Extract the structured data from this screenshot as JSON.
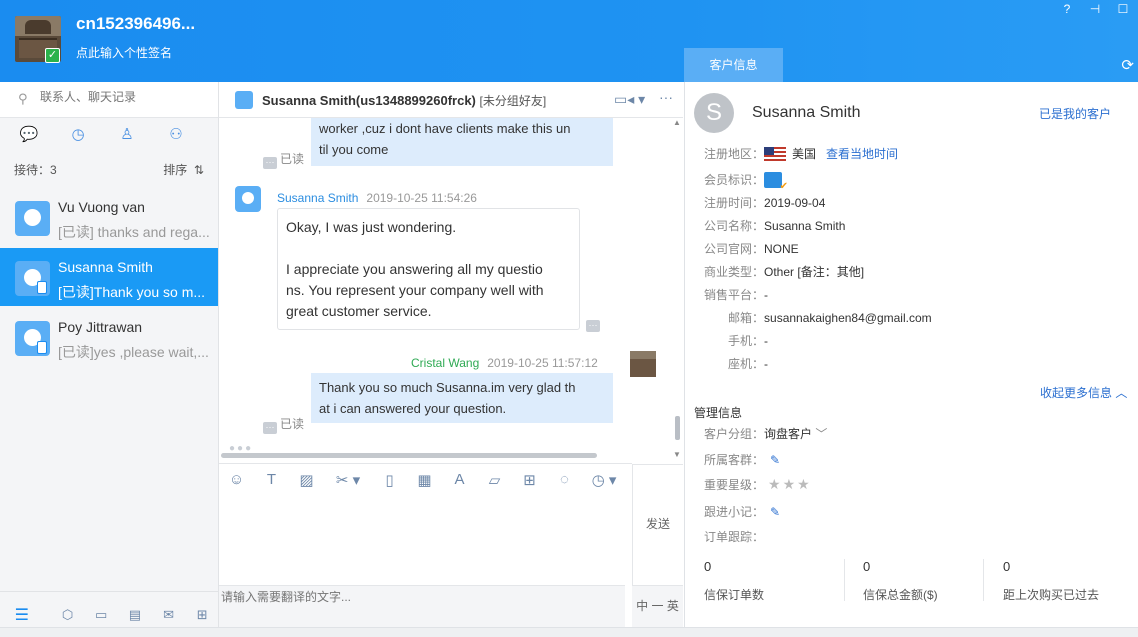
{
  "header": {
    "username": "cn152396496...",
    "signature": "点此输入个性签名",
    "customer_tab": "客户信息",
    "ctrl_help": "?",
    "ctrl_pin": "⊣",
    "ctrl_max": "☐"
  },
  "sidebar": {
    "search_placeholder": "联系人、聊天记录",
    "reception": "接待：3",
    "sort": "排序",
    "contacts": [
      {
        "name": "Vu Vuong van",
        "message": "[已读] thanks and rega..."
      },
      {
        "name": "Susanna Smith",
        "message": "[已读]Thank you so m..."
      },
      {
        "name": "Poy Jittrawan",
        "message": "[已读]yes ,please wait,..."
      }
    ]
  },
  "chat": {
    "title": "Susanna Smith(us1348899260frck)",
    "tag": "[未分组好友]",
    "messages": {
      "m1_line1": "worker ,cuz i dont have clients  make this un",
      "m1_line2": "til you come",
      "m1_read": "已读",
      "m2_sender": "Susanna Smith",
      "m2_time": "2019-10-25 11:54:26",
      "m2_p1": "Okay, I was just wondering.",
      "m2_p2_l1": " I appreciate you answering all my questio",
      "m2_p2_l2": "ns. You represent your company well with",
      "m2_p2_l3": "great customer service.",
      "m3_sender": "Cristal Wang",
      "m3_time": "2019-10-25 11:57:12",
      "m3_line1": "Thank you so much Susanna.im very glad th",
      "m3_line2": "at i can answered your question.",
      "m3_read": "已读"
    },
    "send": "发送",
    "translate_placeholder": "请输入需要翻译的文字...",
    "lang": "中 一 英"
  },
  "customer": {
    "name": "Susanna Smith",
    "status": "已是我的客户",
    "region_label": "注册地区：",
    "region_value": "美国",
    "local_time_link": "查看当地时间",
    "member_label": "会员标识：",
    "reg_time_label": "注册时间：",
    "reg_time_value": "2019-09-04",
    "company_label": "公司名称：",
    "company_value": "Susanna Smith",
    "website_label": "公司官网：",
    "website_value": "NONE",
    "biz_type_label": "商业类型：",
    "biz_type_value": "Other  [备注：其他]",
    "platform_label": "销售平台：",
    "platform_value": "-",
    "email_label": "邮箱：",
    "email_value": "susannakaighen84@gmail.com",
    "mobile_label": "手机：",
    "mobile_value": "-",
    "phone_label": "座机：",
    "phone_value": "-",
    "collapse": "收起更多信息",
    "mgmt_title": "管理信息",
    "group_label": "客户分组：",
    "group_value": "询盘客户",
    "owner_label": "所属客群：",
    "rating_label": "重要星级：",
    "notes_label": "跟进小记：",
    "orders_label": "订单跟踪：",
    "stats": [
      {
        "value": "0",
        "label": "信保订单数"
      },
      {
        "value": "0",
        "label": "信保总金额($)"
      },
      {
        "value": "0",
        "label": "距上次购买已过去"
      }
    ]
  }
}
